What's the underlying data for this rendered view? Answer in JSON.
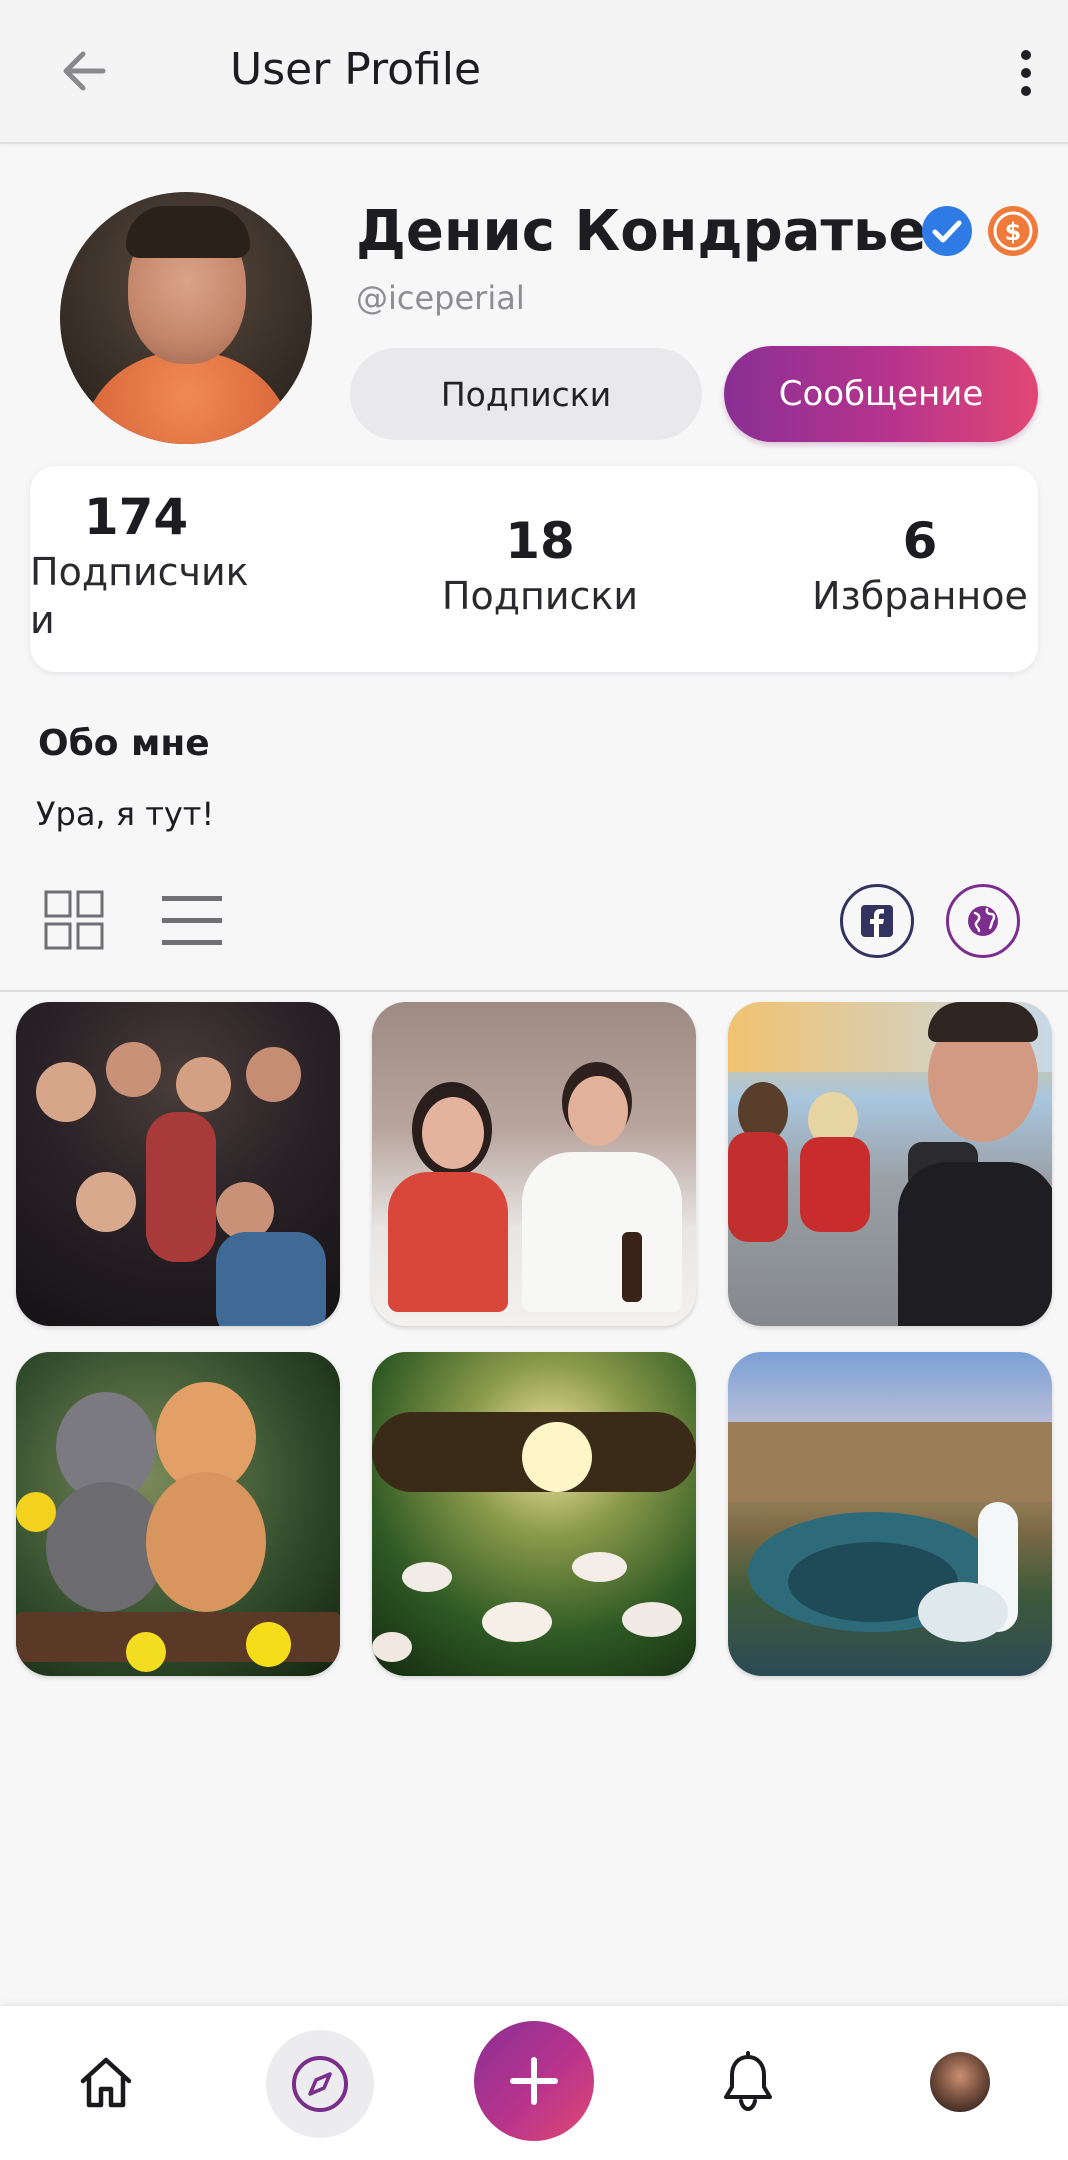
{
  "app_bar": {
    "title": "User Profile",
    "back_icon": "arrow-back-icon",
    "menu_icon": "more-vert-icon"
  },
  "profile": {
    "name": "Денис Кондратьев",
    "handle": "@iceperial",
    "verified_icon": "verified-badge-icon",
    "coin_icon": "dollar-coin-icon",
    "follow_button": "Подписки",
    "message_button": "Сообщение"
  },
  "stats": [
    {
      "value": "174",
      "label": "Подписчики"
    },
    {
      "value": "18",
      "label": "Подписки"
    },
    {
      "value": "6",
      "label": "Избранное"
    }
  ],
  "about": {
    "title": "Обо мне",
    "text": "Ура, я тут!"
  },
  "view_toggle": {
    "grid_icon": "grid-view-icon",
    "list_icon": "list-view-icon"
  },
  "social_links": {
    "facebook_icon": "facebook-icon",
    "website_icon": "globe-icon"
  },
  "photos": [
    {
      "subject": "group-party"
    },
    {
      "subject": "couple-restaurant"
    },
    {
      "subject": "friends-street"
    },
    {
      "subject": "kittens"
    },
    {
      "subject": "tree-sunset-lilies"
    },
    {
      "subject": "canyon-waterfall"
    }
  ],
  "bottom_nav": {
    "items": [
      "home-icon",
      "compass-icon",
      "add-icon",
      "bell-icon",
      "profile-avatar"
    ]
  },
  "colors": {
    "accent_start": "#8a2f95",
    "accent_end": "#e14873",
    "verified": "#2f7be6",
    "coin": "#f07a3a"
  }
}
